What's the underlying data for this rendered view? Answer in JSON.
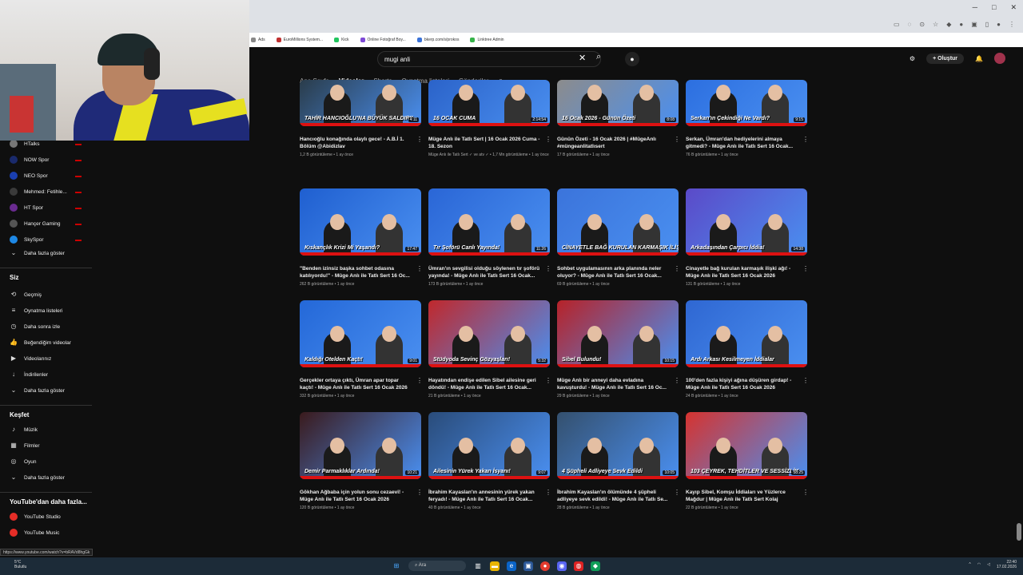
{
  "browser": {
    "bookmarks": [
      {
        "label": "Ads",
        "color": "#888"
      },
      {
        "label": "EuroMillions System...",
        "color": "#c03030"
      },
      {
        "label": "Kick",
        "color": "#22c55e"
      },
      {
        "label": "Online Fotoğraf Boy...",
        "color": "#7e4ad6"
      },
      {
        "label": "bkerp.com/s/prokos",
        "color": "#3a72d8"
      },
      {
        "label": "Linktree Admin",
        "color": "#37b34a"
      }
    ]
  },
  "masthead": {
    "search_value": "mugi anli",
    "create_label": "Oluştur"
  },
  "channel_tabs": [
    "Ana Sayfa",
    "Videolar",
    "Shorts",
    "Oynatma listeleri",
    "Gönderiler"
  ],
  "sidebar": {
    "subscriptions": [
      {
        "label": "HTalks",
        "color": "#777"
      },
      {
        "label": "NOW Spor",
        "color": "#1a2a6c"
      },
      {
        "label": "NEO Spor",
        "color": "#1a3fb0"
      },
      {
        "label": "Mehmed: Fetihle...",
        "color": "#3a3a3a"
      },
      {
        "label": "HT Spor",
        "color": "#6a2b90"
      },
      {
        "label": "Hançer Gaming",
        "color": "#555"
      },
      {
        "label": "SkySpor",
        "color": "#1e88e5"
      }
    ],
    "show_more": "Daha fazla göster",
    "you_header": "Siz",
    "you_items": [
      {
        "label": "Geçmiş",
        "icon": "history-icon",
        "glyph": "⟲"
      },
      {
        "label": "Oynatma listeleri",
        "icon": "playlist-icon",
        "glyph": "≡"
      },
      {
        "label": "Daha sonra izle",
        "icon": "clock-icon",
        "glyph": "◷"
      },
      {
        "label": "Beğendiğim videolar",
        "icon": "thumbs-up-icon",
        "glyph": "👍"
      },
      {
        "label": "Videolarınız",
        "icon": "video-icon",
        "glyph": "▶"
      },
      {
        "label": "İndirilenler",
        "icon": "download-icon",
        "glyph": "↓"
      }
    ],
    "explore_header": "Keşfet",
    "explore_items": [
      {
        "label": "Müzik",
        "icon": "music-icon",
        "glyph": "♪"
      },
      {
        "label": "Filmler",
        "icon": "film-icon",
        "glyph": "▦"
      },
      {
        "label": "Oyun",
        "icon": "gamepad-icon",
        "glyph": "◎"
      }
    ],
    "more_header": "YouTube'dan daha fazla...",
    "more_items": [
      {
        "label": "YouTube Studio",
        "color": "#e52d27"
      },
      {
        "label": "YouTube Music",
        "color": "#e52d27"
      }
    ]
  },
  "videos": [
    {
      "overlay": "TAHİR HANCIOĞLU'NA BÜYÜK SALDIRI!",
      "duration": "4:11",
      "title": "Hancıoğlu konağında olaylı gece! - A.B.İ 1. Bölüm @Abidizlav",
      "views": "1,2 B görüntüleme • 1 ay önce",
      "bg": "#2a3c4a"
    },
    {
      "overlay": "16 OCAK CUMA",
      "duration": "2:14:54",
      "title": "Müge Anlı ile Tatlı Sert | 16 Ocak 2026 Cuma - 18. Sezon",
      "views": "Müge Anlı ile Tatlı Sert ✓ ve atv ✓ • 1,7 Mn görüntüleme • 1 ay önce",
      "bg": "#2b63c9"
    },
    {
      "overlay": "16 Ocak 2026 - Günün Özeti",
      "duration": "8:08",
      "title": "Günün Özeti - 16 Ocak 2026 | #MügeAnlı #müngeanlitatlısert",
      "views": "17 B görüntüleme • 1 ay önce",
      "bg": "#8c8c8c"
    },
    {
      "overlay": "Serkan'ın Çekindiği Ne Vardı?",
      "duration": "9:15",
      "title": "Serkan, Ümran'dan hediyelerini almaya gitmedi? - Müge Anlı ile Tatlı Sert 16 Ocak...",
      "views": "76 B görüntüleme • 1 ay önce",
      "bg": "#2c6fe0"
    },
    {
      "overlay": "Kıskançlık Krizi Mi Yaşandı?",
      "duration": "17:47",
      "title": "\"Benden izinsiz başka sohbet odasına katılıyordu!\" - Müge Anlı ile Tatlı Sert 16 Oc...",
      "views": "262 B görüntüleme • 1 ay önce",
      "bg": "#1f5fd0"
    },
    {
      "overlay": "Tır Şoförü Canlı Yayında!",
      "duration": "11:26",
      "title": "Ümran'ın sevgilisi olduğu söylenen tır şoförü yayında! - Müge Anlı ile Tatlı Sert 16 Ocak...",
      "views": "173 B görüntüleme • 1 ay önce",
      "bg": "#2a66d6"
    },
    {
      "overlay": "CİNAYETLE BAĞ KURULAN KARMAŞIK İLİŞKİ AĞI",
      "duration": "",
      "title": "Sohbet uygulamasının arka planında neler oluyor? - Müge Anlı ile Tatlı Sert 16 Ocak...",
      "views": "69 B görüntüleme • 1 ay önce",
      "bg": "#3b74db"
    },
    {
      "overlay": "Arkadaşından Çarpıcı İddia!",
      "duration": "14:38",
      "title": "Cinayetle bağ kurulan karmaşık ilişki ağı! - Müge Anlı ile Tatlı Sert 16 Ocak 2026",
      "views": "131 B görüntüleme • 1 ay önce",
      "bg": "#5b4ac8"
    },
    {
      "overlay": "Kaldığı Otelden Kaçtı!",
      "duration": "9:01",
      "title": "Gerçekler ortaya çıktı, Ümran apar topar kaçtı! - Müge Anlı ile Tatlı Sert 16 Ocak 2026",
      "views": "332 B görüntüleme • 1 ay önce",
      "bg": "#2468d8"
    },
    {
      "overlay": "Stüdyoda Sevinç Gözyaşları!",
      "duration": "5:32",
      "title": "Hayatından endişe edilen Sibel ailesine geri döndü! - Müge Anlı ile Tatlı Sert 16 Ocak...",
      "views": "21 B görüntüleme • 1 ay önce",
      "bg": "#c0282c"
    },
    {
      "overlay": "Sibel Bulundu!",
      "duration": "10:15",
      "title": "Müge Anlı bir anneyi daha evladına kavuşturdu! - Müge Anlı ile Tatlı Sert 16 Oc...",
      "views": "29 B görüntüleme • 1 ay önce",
      "bg": "#b72228"
    },
    {
      "overlay": "Ardı Arkası Kesilmeyen İddialar",
      "duration": "",
      "title": "100'den fazla kişiyi ağına düşüren girdap! - Müge Anlı ile Tatlı Sert 16 Ocak 2026",
      "views": "24 B görüntüleme • 1 ay önce",
      "bg": "#2f67d2"
    },
    {
      "overlay": "Demir Parmaklıklar Ardında!",
      "duration": "10:21",
      "title": "Gökhan Ağbaba için yolun sonu cezaevi! - Müge Anlı ile Tatlı Sert 16 Ocak 2026",
      "views": "120 B görüntüleme • 1 ay önce",
      "bg": "#3a1a1c"
    },
    {
      "overlay": "Ailesinin Yürek Yakan İsyanı!",
      "duration": "9:07",
      "title": "İbrahim Kayaslan'ın annesinin yürek yakan feryadı! - Müge Anlı ile Tatlı Sert 16 Ocak...",
      "views": "40 B görüntüleme • 1 ay önce",
      "bg": "#2a4c7a"
    },
    {
      "overlay": "4 Şüpheli Adliyeye Sevk Edildi",
      "duration": "10:05",
      "title": "İbrahim Kayaslan'ın ölümünde 4 şüpheli adliyeye sevk edildi! - Müge Anlı ile Tatlı Se...",
      "views": "28 B görüntüleme • 1 ay önce",
      "bg": "#34506e"
    },
    {
      "overlay": "103 ÇEYREK, TEHDİTLER VE SESSİZLİK",
      "duration": "58:25",
      "title": "Kayıp Sibel, Komşu İddiaları ve Yüzlerce Mağdur | Müge Anlı ile Tatlı Sert Kolaj",
      "views": "22 B görüntüleme • 1 ay önce",
      "bg": "#d6332f"
    }
  ],
  "status_url": "https://www.youtube.com/watch?v=bRAVd8hgGk",
  "taskbar": {
    "weather_temp": "5°C",
    "weather_desc": "Bulutlu",
    "search_label": "Ara",
    "time": "22:40",
    "date": "17.02.2026"
  }
}
